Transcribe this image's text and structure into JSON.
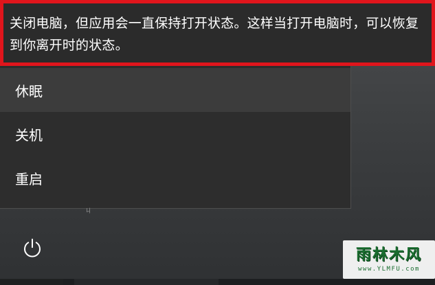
{
  "tooltip": {
    "text": "关闭电脑，但应用会一直保持打开状态。这样当打开电脑时，可以恢复到你离开时的状态。"
  },
  "power_menu": {
    "items": [
      {
        "label": "休眠",
        "highlighted": true
      },
      {
        "label": "关机",
        "highlighted": false
      },
      {
        "label": "重启",
        "highlighted": false
      }
    ]
  },
  "residue_glyph": "ㄐ",
  "power_button": {
    "icon": "power-icon"
  },
  "watermark": {
    "title": "雨林木风",
    "url": "www.YLMFU.com"
  },
  "colors": {
    "highlight_border": "#e0151c",
    "menu_background": "#2d2d2d",
    "menu_hover": "#3c3c3c",
    "watermark_green": "#1a6d2f"
  }
}
